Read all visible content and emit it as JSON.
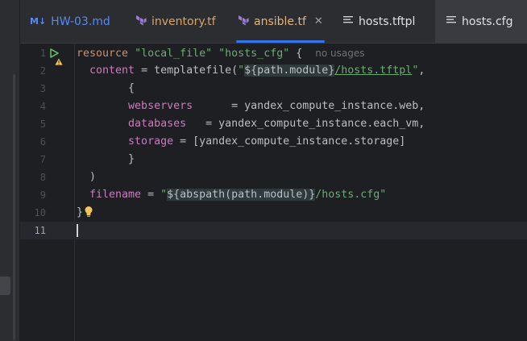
{
  "tabs": [
    {
      "label": "HW-03.md",
      "icon": "markdown-icon",
      "icon_text": "M↓"
    },
    {
      "label": "inventory.tf",
      "icon": "terraform-icon"
    },
    {
      "label": "ansible.tf",
      "icon": "terraform-icon",
      "active": true
    },
    {
      "label": "hosts.tftpl",
      "icon": "text-file-icon"
    },
    {
      "label": "hosts.cfg",
      "icon": "text-file-icon"
    }
  ],
  "editor": {
    "line_numbers": [
      "1",
      "2",
      "3",
      "4",
      "5",
      "6",
      "7",
      "8",
      "9",
      "10",
      "11"
    ],
    "current_line": 11,
    "hint": "no usages",
    "code": {
      "l1_kw": "resource",
      "l1_s1": "\"local_file\"",
      "l1_s2": "\"hosts_cfg\"",
      "l1_end": " {",
      "l2_attr": "content",
      "l2_fn": " = templatefile(",
      "l2_q1": "\"",
      "l2_tpl": "${path.module}",
      "l2_path": "/hosts.tftpl",
      "l2_q2": "\"",
      "l2_end": ",",
      "l3": "{",
      "l4_attr": "webservers",
      "l4_rest": "      = yandex_compute_instance.web,",
      "l5_attr": "databases",
      "l5_rest": "   = yandex_compute_instance.each_vm,",
      "l6_attr": "storage",
      "l6_rest": " = [yandex_compute_instance.storage]",
      "l7": "}",
      "l8": ")",
      "l9_attr": "filename",
      "l9_eq": " = ",
      "l9_q1": "\"",
      "l9_tpl": "${abspath(path.module)}",
      "l9_path": "/hosts.cfg",
      "l9_q2": "\"",
      "l10": "}"
    }
  },
  "colors": {
    "background": "#1e1f22",
    "keyword": "#cf8e6d",
    "string": "#6aab73",
    "attribute": "#c77dbb",
    "active_tab_underline": "#3574f0"
  }
}
